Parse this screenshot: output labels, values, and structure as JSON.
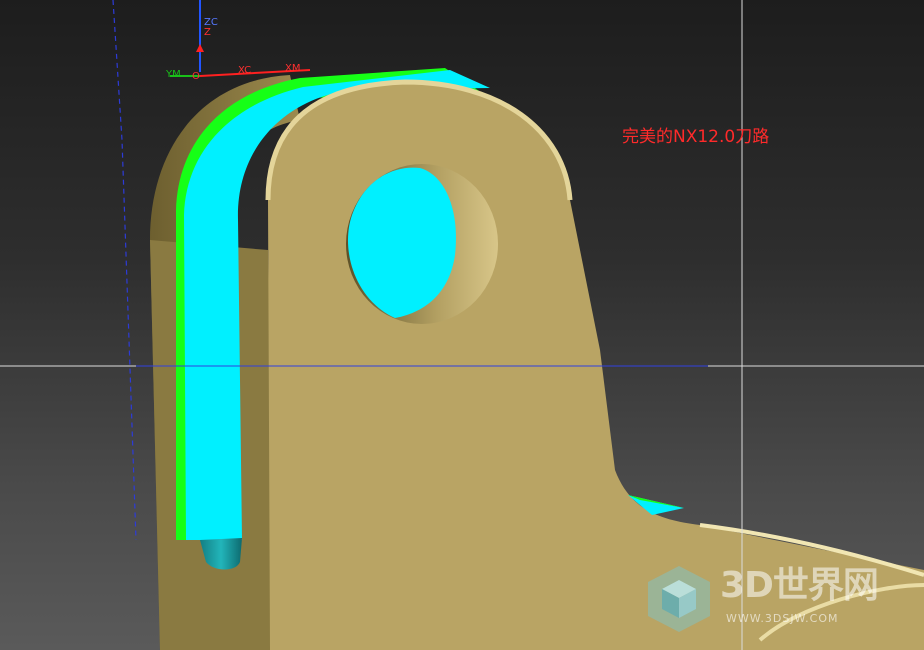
{
  "annotation": {
    "caption": "完美的NX12.0刀路",
    "caption_color": "#ff2a2a"
  },
  "csys": {
    "work": {
      "zc": "ZC",
      "z": "Z",
      "xc": "XC",
      "yc": "YM",
      "xm": "XM",
      "ym": "YM",
      "origin": "O"
    },
    "colors": {
      "z": "#2255ff",
      "x": "#ff2020",
      "y": "#19c019"
    }
  },
  "model": {
    "part_color": "#b9a464",
    "part_shadow_color": "#6e6032",
    "toolpath_color": "#00ffff",
    "toolpath_edge_color": "#16ff16",
    "tool_color": "#1aa3a8"
  },
  "watermark": {
    "text": "3D世界网",
    "url": "WWW.3DSJW.COM"
  }
}
